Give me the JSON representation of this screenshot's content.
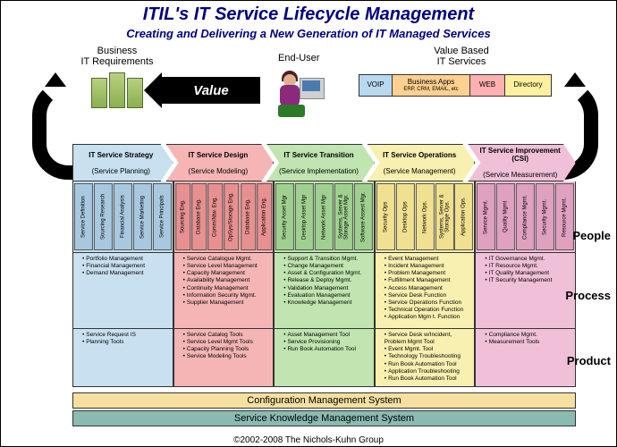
{
  "title": "ITIL's IT Service Lifecycle Management",
  "subtitle": "Creating and Delivering a New Generation of IT Managed Services",
  "topLabels": {
    "business": "Business\nIT Requirements",
    "endUser": "End-User",
    "valueBased": "Value Based\nIT Services",
    "valueArrow": "Value"
  },
  "serviceBoxes": {
    "voip": "VOIP",
    "businessApps": {
      "title": "Business Apps",
      "sub": "ERP, CRM, EMAIL, etc"
    },
    "web": "WEB",
    "directory": "Directory"
  },
  "phases": [
    {
      "color": "blue",
      "header": {
        "title": "IT Service Strategy",
        "sub": "(Service Planning)"
      },
      "people": [
        "Service Definition",
        "Sourcing Research",
        "Financial Analysis",
        "Service Marketing",
        "Service Principals"
      ],
      "process": [
        "Portfolio Management",
        "Financial Management",
        "Demand Management"
      ],
      "product": [
        "Service Request IS",
        "Planning Tools"
      ]
    },
    {
      "color": "red",
      "header": {
        "title": "IT Service Design",
        "sub": "(Service Modeling)"
      },
      "people": [
        "Sourcing Eng.",
        "Database Eng.",
        "Comm/Ntw. Eng.",
        "OpSys/Storage Eng.",
        "Database Eng.",
        "Application Eng."
      ],
      "process": [
        "Service Catalogue Mgmt.",
        "Service Level Management",
        "Capacity Management",
        "Availability Management",
        "Continuity Management",
        "Information Security Mgmt.",
        "Supplier Management"
      ],
      "product": [
        "Service Catalog Tools",
        "Service Level Mgmt Tools",
        "Capacity Planning Tools",
        "Service Modeling Tools"
      ]
    },
    {
      "color": "green",
      "header": {
        "title": "IT Service Transition",
        "sub": "(Service Implementation)"
      },
      "people": [
        "Security Asset Mgr",
        "Desktop Asset Mgr",
        "Network Asset Mgr",
        "Systems, Server & Storage Asset Mgr.",
        "Software Assest Mgr."
      ],
      "process": [
        "Support & Transition Mgmt.",
        "Change Management",
        "Asset & Configuration Mgmt.",
        "Release & Deploy Mgmt.",
        "Validation Management",
        "Evaluation Management",
        "Knowledge Management"
      ],
      "product": [
        "Asset Management Tool",
        "Service Provisioning",
        "Run Book Automation Tool"
      ]
    },
    {
      "color": "yellow",
      "header": {
        "title": "IT Service Operations",
        "sub": "(Service Management)"
      },
      "people": [
        "Security Ops",
        "Desktop Ops",
        "Network Ops.",
        "Systems, Server & Storage Ops.",
        "Application Ops."
      ],
      "process": [
        "Event Management",
        "Incident Management",
        "Problem Management",
        "Fulfillment Management",
        "Access Management",
        "Service Desk Function",
        "Service Operations Function",
        "Technical Operation Function",
        "Application Mgm t. Function"
      ],
      "product": [
        "Service Desk w/Incident, Problem Mgmt Tool",
        "Event Mgmt. Tool",
        "Technology Troubleshooting",
        "Run Book Automation Tool",
        "Application Troubleshooting",
        "Run Book Automation Tool"
      ]
    },
    {
      "color": "pink",
      "header": {
        "title": "IT Service Improvement (CSI)",
        "sub": "(Service Measurement)"
      },
      "people": [
        "Service Mgmt.",
        "Quality Mgmt",
        "Compliance Mgmt.",
        "Security Mgmt.",
        "Resource Mgmt."
      ],
      "process": [
        "IT Governance Mgmt.",
        "IT Resource Mgmt.",
        "IT Quality Management",
        "IT Security Management"
      ],
      "product": [
        "Compliance Mgmt.",
        "Measurement Tools"
      ]
    }
  ],
  "sideLabels": {
    "people": "People",
    "process": "Process",
    "product": "Product"
  },
  "foundations": {
    "config": "Configuration Management System",
    "knowledge": "Service Knowledge Management System"
  },
  "copyright": "©2002-2008 The Nichols-Kuhn Group"
}
